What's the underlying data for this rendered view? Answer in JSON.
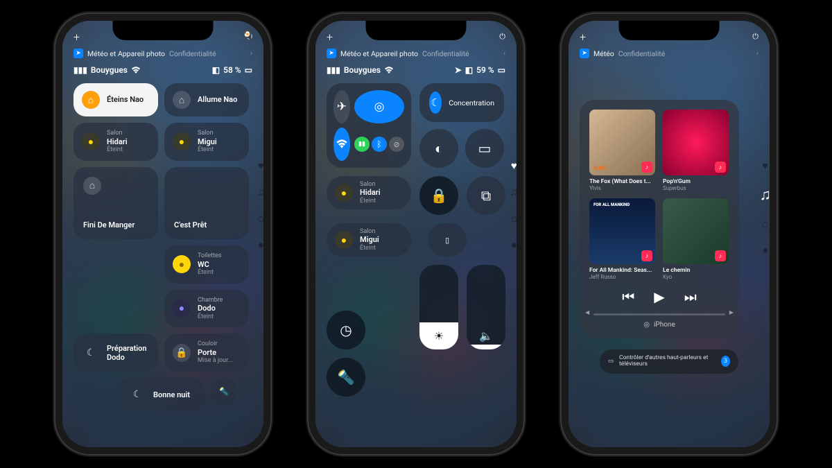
{
  "phone1": {
    "topbar": {
      "banner_app": "Météo et Appareil photo",
      "banner_section": "Confidentialité"
    },
    "status": {
      "carrier": "Bouygues",
      "battery": "58 %"
    },
    "tiles": {
      "eteins_nao": "Éteins Nao",
      "allume_nao": "Allume Nao",
      "hidari": {
        "room": "Salon",
        "name": "Hidari",
        "state": "Éteint"
      },
      "migui": {
        "room": "Salon",
        "name": "Migui",
        "state": "Éteint"
      },
      "fini_manger": "Fini De Manger",
      "cest_pret": "C'est Prêt",
      "wc": {
        "room": "Toilettes",
        "name": "WC",
        "state": "Éteint"
      },
      "dodo": {
        "room": "Chambre",
        "name": "Dodo",
        "state": "Éteint"
      },
      "prep_dodo": "Préparation Dodo",
      "porte": {
        "room": "Couloir",
        "name": "Porte",
        "state": "Mise à jour..."
      },
      "bonne_nuit": "Bonne nuit"
    }
  },
  "phone2": {
    "topbar": {
      "banner_app": "Météo et Appareil photo",
      "banner_section": "Confidentialité"
    },
    "status": {
      "carrier": "Bouygues",
      "battery": "59 %"
    },
    "focus": "Concentration",
    "hidari": {
      "room": "Salon",
      "name": "Hidari",
      "state": "Éteint"
    },
    "migui": {
      "room": "Salon",
      "name": "Migui",
      "state": "Éteint"
    },
    "brightness_pct": 32,
    "volume_pct": 6
  },
  "phone3": {
    "topbar": {
      "banner_app": "Météo",
      "banner_section": "Confidentialité"
    },
    "albums": [
      {
        "title": "The Fox (What Does t...",
        "artist": "Ylvis"
      },
      {
        "title": "Pop'n'Gum",
        "artist": "Superbus"
      },
      {
        "title": "For All Mankind: Seas...",
        "artist": "Jeff Russo"
      },
      {
        "title": "Le chemin",
        "artist": "Kyo"
      }
    ],
    "device": "iPhone",
    "other": {
      "label": "Contrôler d'autres haut-parleurs et téléviseurs",
      "count": "3"
    }
  }
}
